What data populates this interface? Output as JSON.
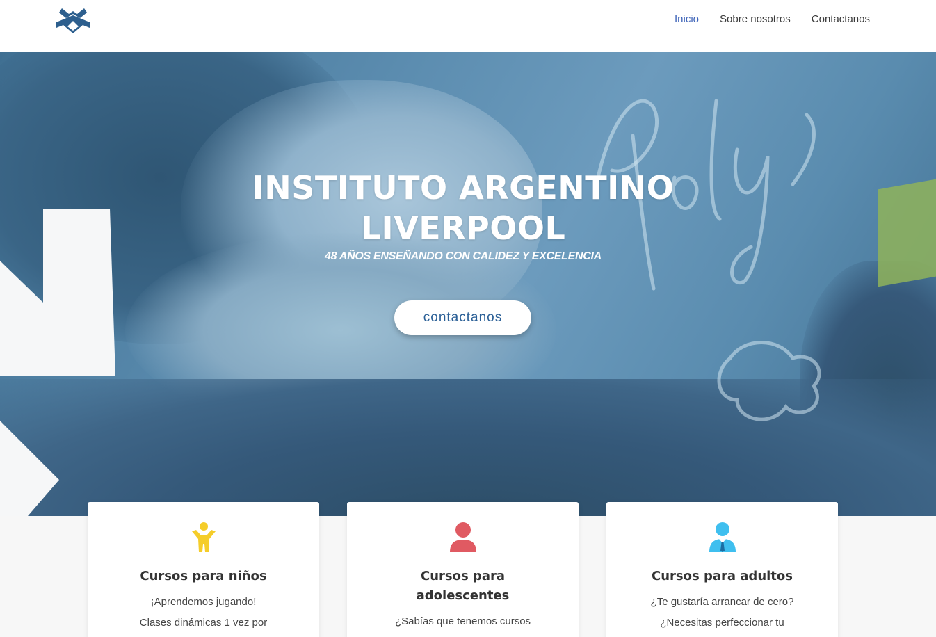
{
  "nav": {
    "items": [
      "Inicio",
      "Sobre nosotros",
      "Contactanos"
    ]
  },
  "hero": {
    "title_line1": "INSTITUTO ARGENTINO",
    "title_line2": "LIVERPOOL",
    "subtitle": "48 AÑOS ENSEÑANDO CON CALIDEZ Y EXCELENCIA",
    "button": "contactanos"
  },
  "cards": [
    {
      "title": "Cursos para niños",
      "line1": "¡Aprendemos jugando!",
      "line2": "Clases dinámicas 1 vez por",
      "icon": "child-icon",
      "color": "#f5cd2a"
    },
    {
      "title_line1": "Cursos para",
      "title_line2": "adolescentes",
      "line1": "¿Sabías que tenemos cursos",
      "icon": "user-icon",
      "color": "#e05a62"
    },
    {
      "title": "Cursos para adultos",
      "line1": "¿Te gustaría arrancar de cero?",
      "line2": "¿Necesitas perfeccionar tu",
      "icon": "businessman-icon",
      "color": "#3fbfef"
    }
  ],
  "colors": {
    "accent": "#3d63b8",
    "button_text": "#2a5f96",
    "logo": "#2d5f8e"
  }
}
